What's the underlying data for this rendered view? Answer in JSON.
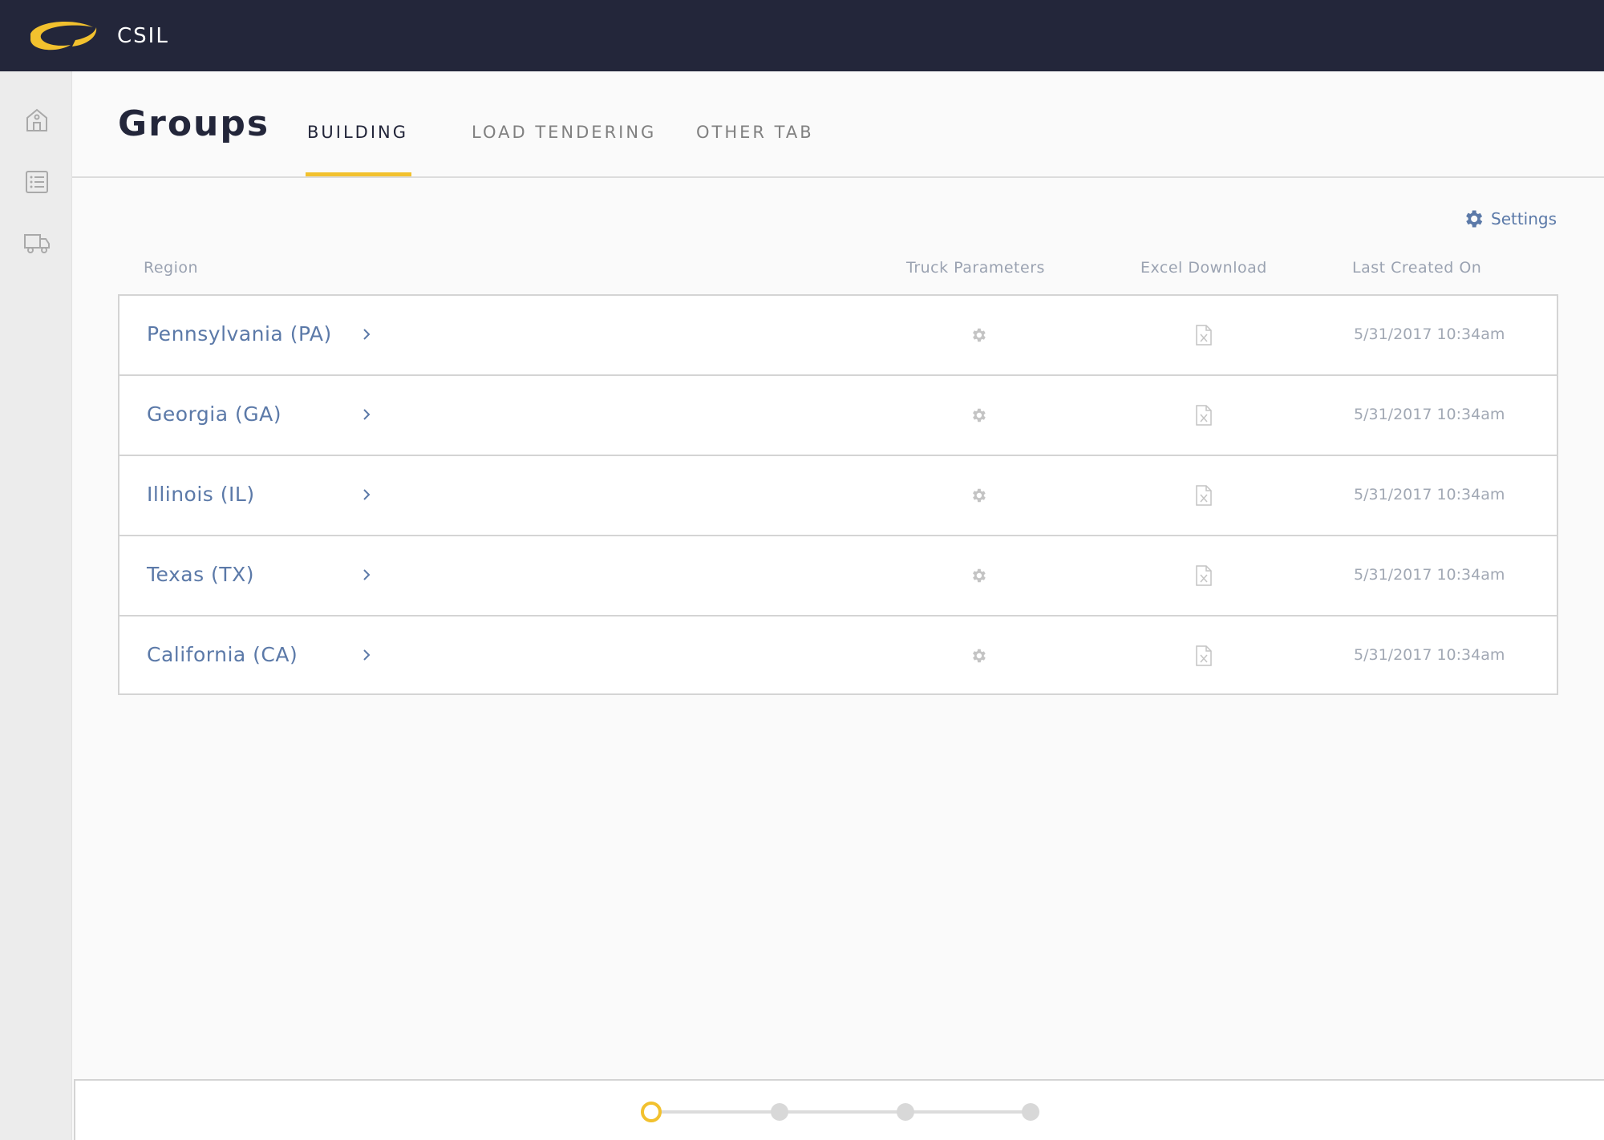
{
  "app": {
    "brand": "CSIL",
    "accent": "#f2c12e",
    "nav_bg": "#23263a",
    "link_color": "#5b79a8"
  },
  "sidebar": {
    "items": [
      {
        "icon": "building-icon"
      },
      {
        "icon": "list-icon"
      },
      {
        "icon": "truck-icon"
      }
    ]
  },
  "header": {
    "title": "Groups",
    "tabs": [
      {
        "label": "BUILDING",
        "active": true
      },
      {
        "label": "LOAD TENDERING",
        "active": false
      },
      {
        "label": "OTHER TAB",
        "active": false
      }
    ]
  },
  "toolbar": {
    "settings_label": "Settings",
    "settings_icon": "gear-icon"
  },
  "table": {
    "columns": [
      "Region",
      "Truck Parameters",
      "Excel Download",
      "Last Created On"
    ],
    "rows": [
      {
        "region": "Pennsylvania (PA)",
        "last_created": "5/31/2017 10:34am"
      },
      {
        "region": "Georgia (GA)",
        "last_created": "5/31/2017 10:34am"
      },
      {
        "region": "Illinois (IL)",
        "last_created": "5/31/2017 10:34am"
      },
      {
        "region": "Texas (TX)",
        "last_created": "5/31/2017 10:34am"
      },
      {
        "region": "California (CA)",
        "last_created": "5/31/2017 10:34am"
      }
    ]
  },
  "stepper": {
    "steps": 4,
    "current": 1
  }
}
